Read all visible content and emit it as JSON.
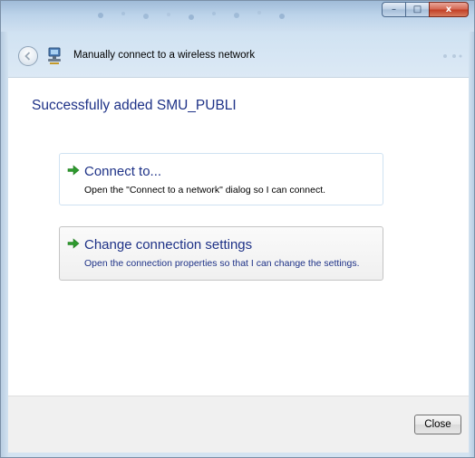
{
  "window": {
    "title": "Manually connect to a wireless network",
    "caption_buttons": {
      "minimize_glyph": "–",
      "maximize_glyph": "□",
      "close_glyph": "x"
    }
  },
  "content": {
    "heading": "Successfully added SMU_PUBLI",
    "options": [
      {
        "title": "Connect to...",
        "description": "Open the \"Connect to a network\" dialog so I can connect.",
        "icon": "green-arrow-icon"
      },
      {
        "title": "Change connection settings",
        "description": "Open the connection properties so that I can change the settings.",
        "icon": "green-arrow-icon"
      }
    ]
  },
  "footer": {
    "close_label": "Close"
  },
  "colors": {
    "link_blue": "#1e3287",
    "arrow_green": "#2e9a2e",
    "close_red": "#c24128"
  }
}
